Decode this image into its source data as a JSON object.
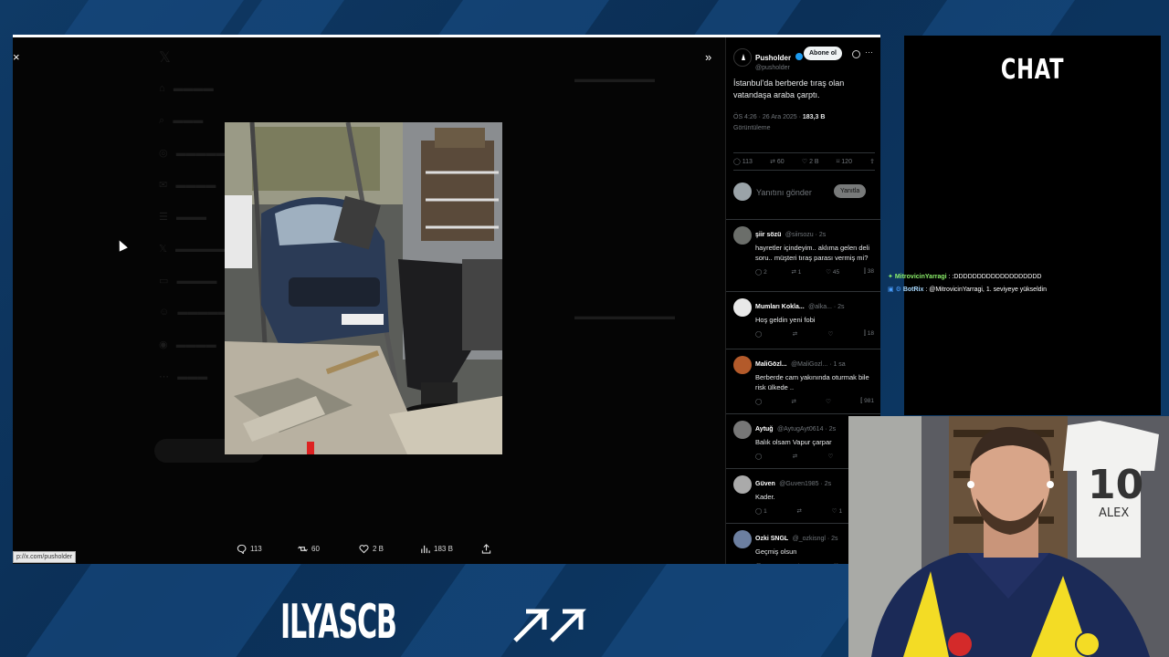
{
  "stream": {
    "brand_logo": "ILYASCB",
    "chat_title": "CHAT"
  },
  "chat": {
    "messages": [
      {
        "user": "MitrovicinYarragi",
        "text": ": :DDDDDDDDDDDDDDDDDDD",
        "color": "#8cf06b"
      },
      {
        "user": "BotRix",
        "text": ": @MitrovicinYarragi, 1. seviyeye yükseldin",
        "color": "#a7d8ff"
      }
    ]
  },
  "viewer": {
    "close_symbol": "×",
    "expand_symbol": "»",
    "status_url": "p://x.com/pusholder",
    "actions": {
      "replies": "113",
      "retweets": "60",
      "likes": "2 B",
      "views": "183 B"
    }
  },
  "tweet": {
    "author": {
      "name": "Pusholder",
      "handle": "@pusholder"
    },
    "follow_label": "Abone ol",
    "text": "İstanbul'da berberde tıraş olan vatandaşa araba çarptı.",
    "time": "ÖS 4:26 · 26 Ara 2025 ·",
    "views_count": "183,3 B",
    "views_label": "Görüntüleme",
    "stats": {
      "replies": "113",
      "retweets": "60",
      "likes": "2 B",
      "bookmarks": "120"
    },
    "reply_placeholder": "Yanıtını gönder",
    "reply_button": "Yanıtla"
  },
  "replies": [
    {
      "name": "şiir sözü",
      "handle": "@siirsozu · 2s",
      "text": "hayretler içindeyim.. aklıma gelen deli soru.. müşteri tıraş parası vermiş mi?",
      "stats": [
        "2",
        "1",
        "45",
        "38"
      ]
    },
    {
      "name": "Mumları Kokla...",
      "handle": "@alka... · 2s",
      "text": "Hoş geldin yeni fobi",
      "stats": [
        "",
        "",
        "",
        "18"
      ]
    },
    {
      "name": "MaliGözl...",
      "handle": "@MaliGozl... · 1 sa",
      "text": "Berberde cam yakınında oturmak bile risk ülkede ..",
      "stats": [
        "",
        "",
        "",
        "981"
      ]
    },
    {
      "name": "Aytuğ",
      "handle": "@AytugAyt0614 · 2s",
      "text": "Balık olsam Vapur çarpar",
      "stats": [
        "",
        "",
        "",
        "23"
      ]
    },
    {
      "name": "Güven",
      "handle": "@Guven1985 · 2s",
      "text": "Kader.",
      "stats": [
        "1",
        "",
        "1",
        ""
      ]
    },
    {
      "name": "Ozki SNGL",
      "handle": "@_ozkisngl · 2s",
      "text": "Geçmiş olsun",
      "stats": [
        "",
        "",
        "",
        ""
      ]
    }
  ],
  "webcam": {
    "jersey_number": "10",
    "jersey_name": "ALEX"
  }
}
